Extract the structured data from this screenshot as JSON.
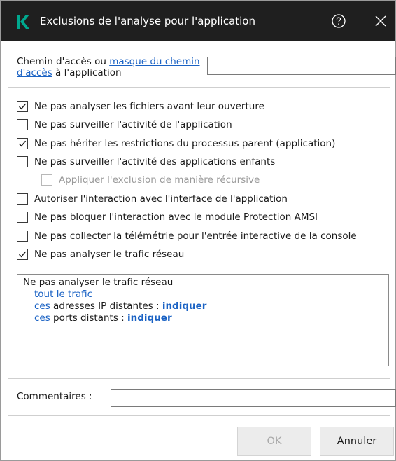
{
  "titlebar": {
    "title": "Exclusions de l'analyse pour l'application",
    "logo_icon": "kaspersky-logo-icon",
    "help_icon": "help-circle-icon",
    "close_icon": "close-icon",
    "background": "#1f1f1f",
    "logo_color": "#00a88e"
  },
  "path_field": {
    "label_before": "Chemin d'accès ou ",
    "label_link": "masque du chemin d'accès",
    "label_after": " à l'application",
    "value": ""
  },
  "options": [
    {
      "label": "Ne pas analyser les fichiers avant leur ouverture",
      "checked": true,
      "disabled": false
    },
    {
      "label": "Ne pas surveiller l'activité de l'application",
      "checked": false,
      "disabled": false
    },
    {
      "label": "Ne pas hériter les restrictions du processus parent (application)",
      "checked": true,
      "disabled": false
    },
    {
      "label": "Ne pas surveiller l'activité des applications enfants",
      "checked": false,
      "disabled": false
    },
    {
      "label": "Appliquer l'exclusion de manière récursive",
      "checked": false,
      "disabled": true
    },
    {
      "label": "Autoriser l'interaction avec l'interface de l'application",
      "checked": false,
      "disabled": false
    },
    {
      "label": "Ne pas bloquer l'interaction avec le module Protection AMSI",
      "checked": false,
      "disabled": false
    },
    {
      "label": "Ne pas collecter la télémétrie pour l'entrée interactive de la console",
      "checked": false,
      "disabled": false
    },
    {
      "label": "Ne pas analyser le trafic réseau",
      "checked": true,
      "disabled": false
    }
  ],
  "traffic_box": {
    "heading": "Ne pas analyser le trafic réseau",
    "all_traffic_link": "tout le trafic",
    "ip_line": {
      "link": "ces",
      "text": " adresses IP distantes : ",
      "action": "indiquer"
    },
    "port_line": {
      "link": "ces",
      "text": " ports distants : ",
      "action": "indiquer"
    }
  },
  "comments": {
    "label": "Commentaires :",
    "value": ""
  },
  "buttons": {
    "ok": "OK",
    "cancel": "Annuler"
  }
}
